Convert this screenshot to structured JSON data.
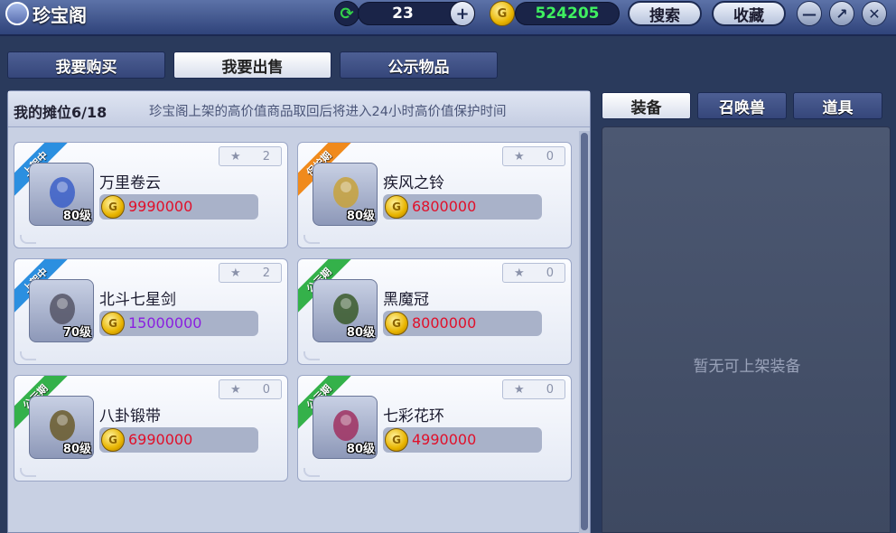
{
  "title_bar": {
    "app_title": "珍宝阁",
    "counter_value": "23",
    "gold_amount": "524205",
    "search_label": "搜索",
    "favorites_label": "收藏"
  },
  "main_tabs": [
    {
      "label": "我要购买",
      "active": false
    },
    {
      "label": "我要出售",
      "active": true
    },
    {
      "label": "公示物品",
      "active": false
    }
  ],
  "stall": {
    "count_label": "我的摊位6/18",
    "notice": "珍宝阁上架的高价值商品取回后将进入24小时高价值保护时间"
  },
  "items": [
    {
      "status": "上架中",
      "status_color": "blue",
      "name": "万里卷云",
      "level": "80级",
      "price": "9990000",
      "price_color": "red",
      "favorites": "2",
      "icon": "whip-icon",
      "glyph_color": "#3b5fc8"
    },
    {
      "status": "保护期",
      "status_color": "orange",
      "name": "疾风之铃",
      "level": "80级",
      "price": "6800000",
      "price_color": "red",
      "favorites": "0",
      "icon": "bell-icon",
      "glyph_color": "#c8a23b"
    },
    {
      "status": "上架中",
      "status_color": "blue",
      "name": "北斗七星剑",
      "level": "70级",
      "price": "15000000",
      "price_color": "purple",
      "favorites": "2",
      "icon": "sword-icon",
      "glyph_color": "#555566"
    },
    {
      "status": "公示期",
      "status_color": "green",
      "name": "黑魔冠",
      "level": "80级",
      "price": "8000000",
      "price_color": "red",
      "favorites": "0",
      "icon": "crown-icon",
      "glyph_color": "#3a5a2a"
    },
    {
      "status": "公示期",
      "status_color": "green",
      "name": "八卦锻带",
      "level": "80级",
      "price": "6990000",
      "price_color": "red",
      "favorites": "0",
      "icon": "belt-icon",
      "glyph_color": "#6a5a2a"
    },
    {
      "status": "公示期",
      "status_color": "green",
      "name": "七彩花环",
      "level": "80级",
      "price": "4990000",
      "price_color": "red",
      "favorites": "0",
      "icon": "wreath-icon",
      "glyph_color": "#a03060"
    }
  ],
  "category_tabs": [
    {
      "label": "装备",
      "active": true
    },
    {
      "label": "召唤兽",
      "active": false
    },
    {
      "label": "道具",
      "active": false
    }
  ],
  "right_panel": {
    "empty_message": "暂无可上架装备"
  },
  "colors": {
    "price_red": "#e0102a",
    "price_purple": "#8a1ee0",
    "ribbon_blue": "#2b8fe0",
    "ribbon_orange": "#f08a1c",
    "ribbon_green": "#34b14a"
  }
}
